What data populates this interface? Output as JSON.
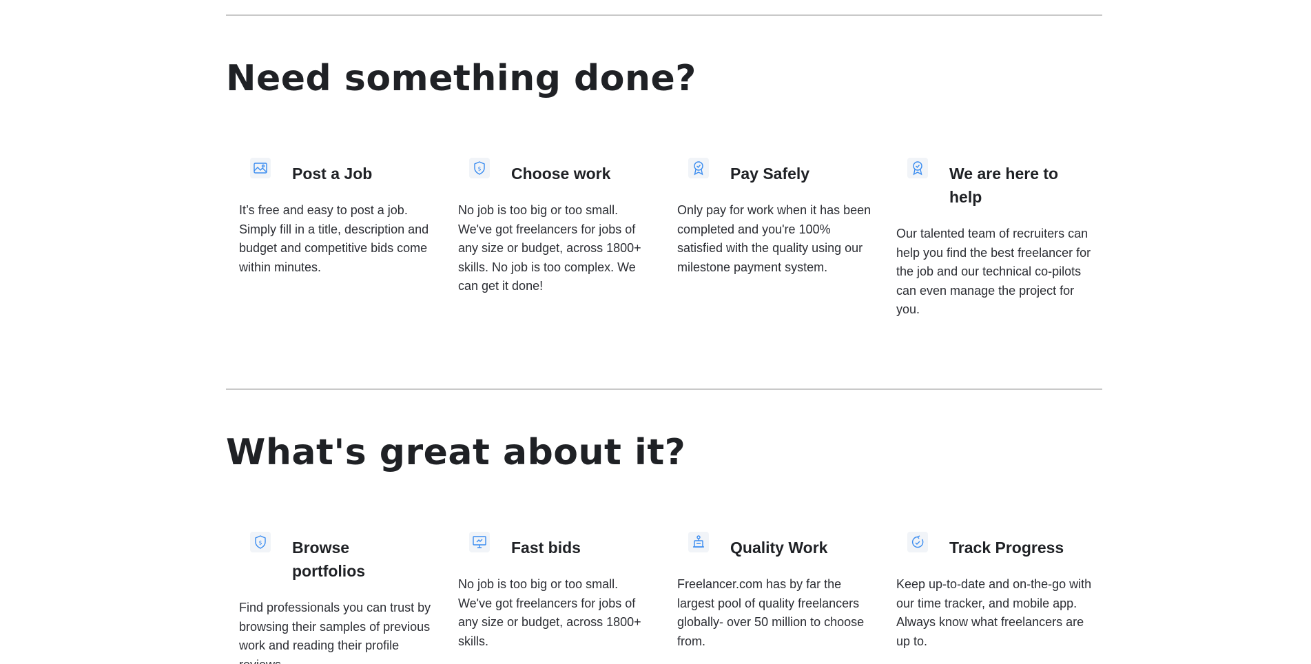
{
  "sections": [
    {
      "title": "Need something done?",
      "cards": [
        {
          "icon": "image-icon",
          "title": "Post a Job",
          "text": "It’s free and easy to post a job. Simply fill in a title, description and budget and competitive bids come within minutes."
        },
        {
          "icon": "dollar-shield-icon",
          "title": "Choose work",
          "text": "No job is too big or too small. We've got freelancers for jobs of any size or budget, across 1800+ skills. No job is too complex. We can get it done!"
        },
        {
          "icon": "award-badge-icon",
          "title": "Pay Safely",
          "text": "Only pay for work when it has been completed and you're 100% satisfied with the quality using our milestone payment system."
        },
        {
          "icon": "award-badge-icon",
          "title": "We are here to help",
          "text": "Our talented team of recruiters can help you find the best freelancer for the job and our technical co-pilots can even manage the project for you."
        }
      ]
    },
    {
      "title": "What's great about it?",
      "cards": [
        {
          "icon": "dollar-shield-icon",
          "title": "Browse portfolios",
          "text": "Find professionals you can trust by browsing their samples of previous work and reading their profile reviews."
        },
        {
          "icon": "monitor-icon",
          "title": "Fast bids",
          "text": "No job is too big or too small. We've got freelancers for jobs of any size or budget, across 1800+ skills."
        },
        {
          "icon": "user-quality-icon",
          "title": "Quality Work",
          "text": "Freelancer.com has by far the largest pool of quality freelancers globally- over 50 million to choose from."
        },
        {
          "icon": "progress-icon",
          "title": "Track Progress",
          "text": "Keep up-to-date and on-the-go with our time tracker, and mobile app. Always know what freelancers are up to."
        }
      ]
    }
  ],
  "colors": {
    "icon_accent": "#3a8cf0",
    "icon_bg": "#f1f4f8",
    "divider": "#c9c9c9",
    "text": "#1f2125"
  }
}
